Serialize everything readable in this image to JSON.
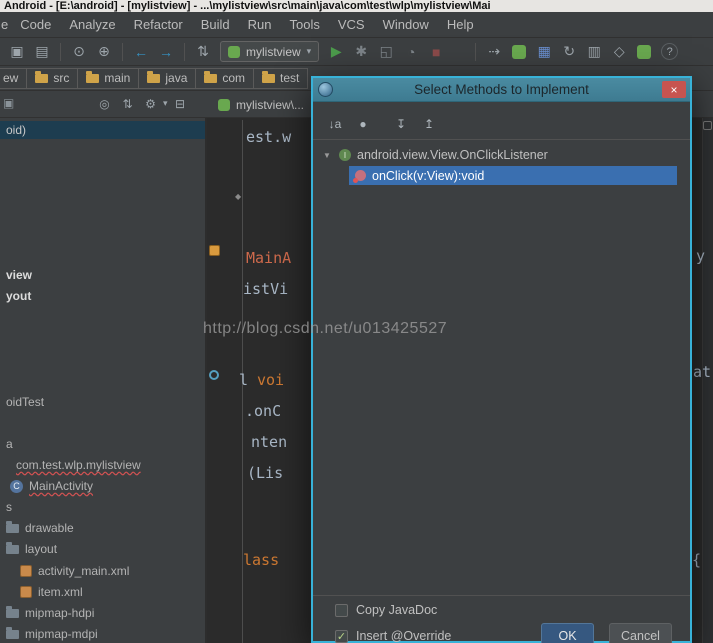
{
  "colors": {
    "titlebar_bg": "#e7e5e2",
    "panel_bg": "#3c3f41",
    "editor_bg": "#2b2b2b",
    "text": "#bbbbbb",
    "selection_blue": "#3a6fb0",
    "tree_selection": "#1d3d50",
    "dialog_border": "#38b2d8",
    "dialog_title_bg": "#4a8ba1",
    "close_red": "#c75450",
    "keyword_orange": "#cc7832",
    "class_red": "#cf6a4c",
    "accent_teal": "#3592c4",
    "folder_yellow": "#cfa349",
    "run_green": "#4c9b4c",
    "droid_green": "#69a84f",
    "watermark_gray": "#9b9b9b"
  },
  "window": {
    "title": "Android - [E:\\android] - [mylistview] - ...\\mylistview\\src\\main\\java\\com\\test\\wlp\\mylistview\\Mai"
  },
  "menu": {
    "fragment": "e",
    "items": [
      "Code",
      "Analyze",
      "Refactor",
      "Build",
      "Run",
      "Tools",
      "VCS",
      "Window",
      "Help"
    ]
  },
  "toolbar": {
    "run_config": "mylistview"
  },
  "navbar": {
    "fragment": "ew",
    "items": [
      "src",
      "main",
      "java",
      "com",
      "test"
    ]
  },
  "tabs": {
    "active": "mylistview\\..."
  },
  "project": {
    "items": [
      {
        "label": "oid)",
        "selected": true
      },
      {
        "label": "view"
      },
      {
        "label": "yout"
      },
      {
        "label": "oidTest"
      },
      {
        "label": "a"
      },
      {
        "label": "com.test.wlp.mylistview"
      },
      {
        "label": "MainActivity"
      },
      {
        "label": "s"
      },
      {
        "label": "drawable"
      },
      {
        "label": "layout"
      },
      {
        "label": "activity_main.xml"
      },
      {
        "label": "item.xml"
      },
      {
        "label": "mipmap-hdpi"
      },
      {
        "label": "mipmap-mdpi"
      }
    ]
  },
  "editor": {
    "watermark": "http://blog.csdn.net/u013425527",
    "fragments": [
      {
        "text": "est.w"
      },
      {
        "text": "MainA"
      },
      {
        "text": "istVi"
      },
      {
        "text": "l"
      },
      {
        "text": "voi"
      },
      {
        "text": ".onC"
      },
      {
        "text": "nten"
      },
      {
        "text": "(Lis"
      },
      {
        "text": "lass"
      },
      {
        "text": "y"
      },
      {
        "text": "at"
      },
      {
        "text": "{"
      }
    ]
  },
  "dialog": {
    "title": "Select Methods to Implement",
    "tree": {
      "parent": "android.view.View.OnClickListener",
      "method": "onClick(v:View):void"
    },
    "options": [
      {
        "label": "Copy JavaDoc",
        "checked": false
      },
      {
        "label": "Insert @Override",
        "checked": true
      }
    ],
    "buttons": {
      "ok": "OK",
      "cancel": "Cancel"
    }
  },
  "icons": {
    "open": "▣",
    "save": "▤",
    "search": "⊙",
    "find": "⊕",
    "back": "←",
    "forward": "→",
    "history": "⇅",
    "caret": "▾",
    "run": "▶",
    "debug": "✱",
    "coverage": "◱",
    "profiler": "◔",
    "stop": "■",
    "attach": "⇢",
    "sdk": "▦",
    "sync": "↻",
    "monitor": "▥",
    "gradle": "◇",
    "help": "?",
    "target": "◎",
    "sort": "⇅",
    "gear": "⚙",
    "collapse": "⊟",
    "panel_stub": "▣",
    "tree_expanded": "▼",
    "close": "×",
    "check": "✓",
    "sort_alpha": "↓a",
    "show_all": "●",
    "expand_all": "↧",
    "collapse_all": "↥",
    "interface_letter": "I",
    "class_c": "C",
    "diamond": "◆"
  }
}
